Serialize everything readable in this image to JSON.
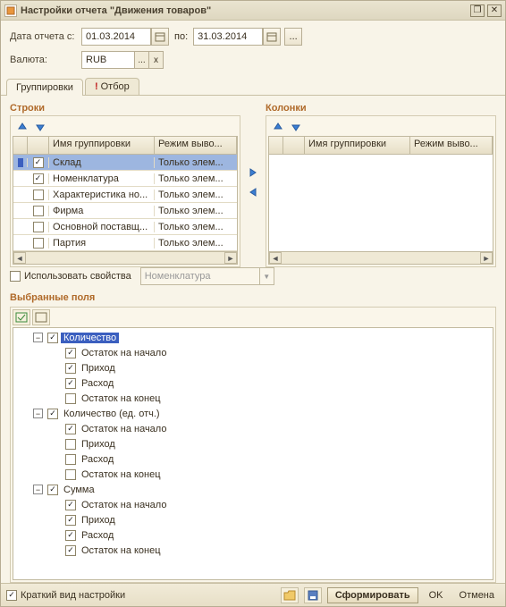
{
  "window": {
    "title": "Настройки отчета \"Движения товаров\""
  },
  "form": {
    "date_from_label": "Дата отчета с:",
    "date_from": "01.03.2014",
    "date_to_label": "по:",
    "date_to": "31.03.2014",
    "ellipsis": "...",
    "currency_label": "Валюта:",
    "currency": "RUB",
    "x": "x"
  },
  "tabs": {
    "groupings": "Группировки",
    "filter": "Отбор"
  },
  "rows_section": {
    "title": "Строки",
    "col_name": "Имя группировки",
    "col_mode": "Режим выво...",
    "items": [
      {
        "checked": true,
        "selected": true,
        "name": "Склад",
        "mode": "Только элем..."
      },
      {
        "checked": true,
        "selected": false,
        "name": "Номенклатура",
        "mode": "Только элем..."
      },
      {
        "checked": false,
        "selected": false,
        "name": "Характеристика но...",
        "mode": "Только элем..."
      },
      {
        "checked": false,
        "selected": false,
        "name": "Фирма",
        "mode": "Только элем..."
      },
      {
        "checked": false,
        "selected": false,
        "name": "Основной поставщ...",
        "mode": "Только элем..."
      },
      {
        "checked": false,
        "selected": false,
        "name": "Партия",
        "mode": "Только элем..."
      }
    ]
  },
  "cols_section": {
    "title": "Колонки",
    "col_name": "Имя группировки",
    "col_mode": "Режим выво..."
  },
  "usechar": {
    "label": "Использовать свойства",
    "combo": "Номенклатура"
  },
  "fields": {
    "title": "Выбранные поля",
    "tree": [
      {
        "level": 0,
        "expand": "-",
        "checked": true,
        "label": "Количество",
        "selected": true
      },
      {
        "level": 1,
        "expand": "",
        "checked": true,
        "label": "Остаток на начало"
      },
      {
        "level": 1,
        "expand": "",
        "checked": true,
        "label": "Приход"
      },
      {
        "level": 1,
        "expand": "",
        "checked": true,
        "label": "Расход"
      },
      {
        "level": 1,
        "expand": "",
        "checked": false,
        "label": "Остаток на конец"
      },
      {
        "level": 0,
        "expand": "-",
        "checked": true,
        "label": "Количество (ед. отч.)"
      },
      {
        "level": 1,
        "expand": "",
        "checked": true,
        "label": "Остаток на начало"
      },
      {
        "level": 1,
        "expand": "",
        "checked": false,
        "label": "Приход"
      },
      {
        "level": 1,
        "expand": "",
        "checked": false,
        "label": "Расход"
      },
      {
        "level": 1,
        "expand": "",
        "checked": false,
        "label": "Остаток на конец"
      },
      {
        "level": 0,
        "expand": "-",
        "checked": true,
        "label": "Сумма"
      },
      {
        "level": 1,
        "expand": "",
        "checked": true,
        "label": "Остаток на начало"
      },
      {
        "level": 1,
        "expand": "",
        "checked": true,
        "label": "Приход"
      },
      {
        "level": 1,
        "expand": "",
        "checked": true,
        "label": "Расход"
      },
      {
        "level": 1,
        "expand": "",
        "checked": true,
        "label": "Остаток на конец"
      }
    ]
  },
  "status": {
    "short_view": "Краткий вид настройки",
    "generate": "Сформировать",
    "ok": "OK",
    "cancel": "Отмена"
  }
}
